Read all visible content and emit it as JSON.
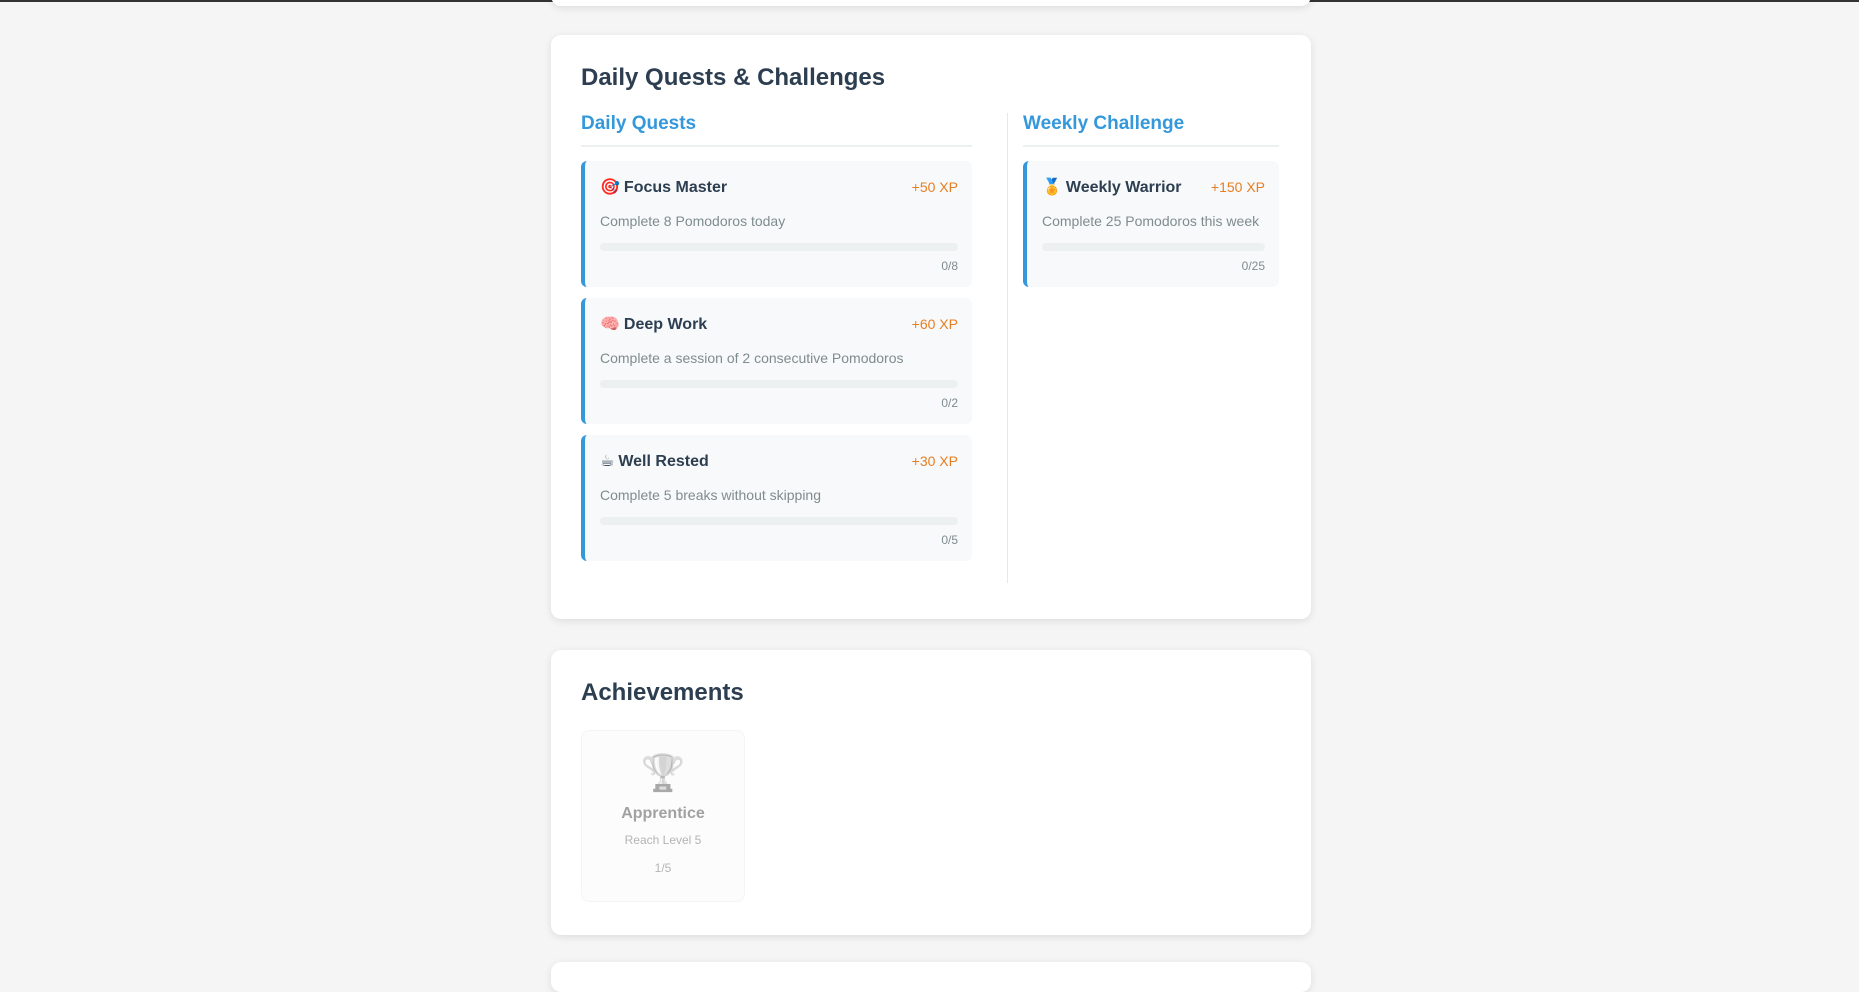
{
  "quests_section": {
    "title": "Daily Quests & Challenges",
    "daily": {
      "title": "Daily Quests",
      "items": [
        {
          "emoji": "🎯",
          "name": "Focus Master",
          "xp": "+50 XP",
          "desc": "Complete 8 Pomodoros today",
          "progress": "0/8",
          "progress_fraction": 0
        },
        {
          "emoji": "🧠",
          "name": "Deep Work",
          "xp": "+60 XP",
          "desc": "Complete a session of 2 consecutive Pomodoros",
          "progress": "0/2",
          "progress_fraction": 0
        },
        {
          "emoji": "☕",
          "name": "Well Rested",
          "xp": "+30 XP",
          "desc": "Complete 5 breaks without skipping",
          "progress": "0/5",
          "progress_fraction": 0
        }
      ]
    },
    "weekly": {
      "title": "Weekly Challenge",
      "items": [
        {
          "emoji": "🏅",
          "name": "Weekly Warrior",
          "xp": "+150 XP",
          "desc": "Complete 25 Pomodoros this week",
          "progress": "0/25",
          "progress_fraction": 0
        }
      ]
    }
  },
  "achievements": {
    "title": "Achievements",
    "items": [
      {
        "icon": "🏆",
        "name": "Apprentice",
        "desc": "Reach Level 5",
        "progress": "1/5",
        "locked": true
      }
    ]
  },
  "colors": {
    "accent": "#3498db",
    "xp": "#e67e22",
    "heading": "#2c3e50",
    "muted": "#7f8c8d",
    "background": "#f5f5f5"
  }
}
